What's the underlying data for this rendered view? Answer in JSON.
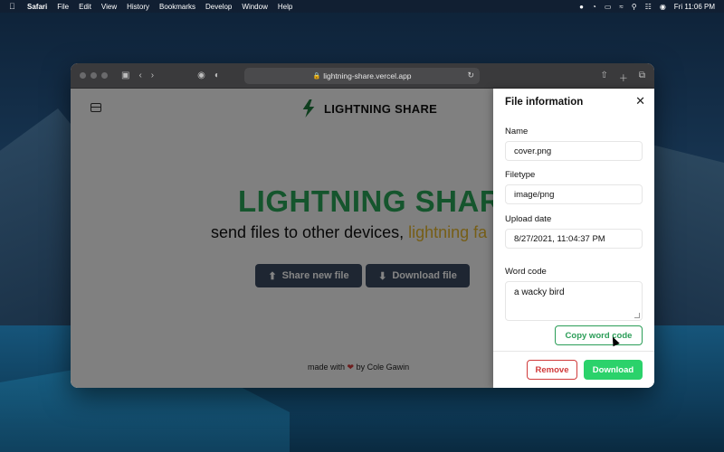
{
  "menubar": {
    "app": "Safari",
    "items": [
      "File",
      "Edit",
      "View",
      "History",
      "Bookmarks",
      "Develop",
      "Window",
      "Help"
    ],
    "clock": "Fri 11:06 PM"
  },
  "browser": {
    "url": "lightning-share.vercel.app"
  },
  "site": {
    "brand": "LIGHTNING SHARE",
    "hero_title": "LIGHTNING SHARE",
    "hero_sub_main": "send files to other devices, ",
    "hero_sub_accent": "lightning fa",
    "share_button": "Share new file",
    "download_button": "Download file",
    "footer_prefix": "made with",
    "footer_suffix": "by Cole Gawin",
    "colors": {
      "accent_green": "#2aa356",
      "accent_yellow": "#e3b52c",
      "button_dark": "#3b4a60"
    }
  },
  "drawer": {
    "title": "File information",
    "name_label": "Name",
    "name_value": "cover.png",
    "filetype_label": "Filetype",
    "filetype_value": "image/png",
    "upload_label": "Upload date",
    "upload_value": "8/27/2021, 11:04:37 PM",
    "wordcode_label": "Word code",
    "wordcode_value": "a wacky bird",
    "copy_button": "Copy word code",
    "remove_button": "Remove",
    "download_button": "Download",
    "colors": {
      "danger": "#d03a3a",
      "success": "#2bd26b"
    }
  }
}
